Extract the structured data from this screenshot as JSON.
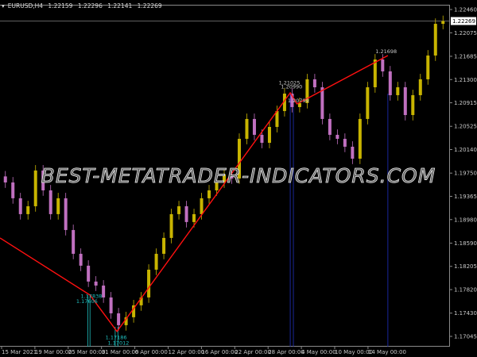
{
  "header": {
    "symbol": "EURUSD,H4",
    "open": "1.22159",
    "high": "1.22296",
    "low": "1.22141",
    "close": "1.22269"
  },
  "watermark": "BEST-METATRADER-INDICATORS.COM",
  "colors": {
    "bull": "#c8b400",
    "bear": "#c070c0",
    "zigzag": "#ff1010",
    "cyan": "#20c0c0",
    "blue": "#2030c0",
    "axis": "#8a8a8a"
  },
  "chart_data": {
    "type": "candlestick",
    "title": "EURUSD,H4",
    "ylim": [
      1.1695,
      1.2255
    ],
    "yticks": [
      "1.22460",
      "1.22075",
      "1.21685",
      "1.21300",
      "1.20915",
      "1.20525",
      "1.20140",
      "1.19750",
      "1.19365",
      "1.18980",
      "1.18590",
      "1.18205",
      "1.17820",
      "1.17430",
      "1.17045"
    ],
    "current_price": "1.22269",
    "xticks": [
      "15 Mar 2021",
      "19 Mar 00:00",
      "25 Mar 00:00",
      "31 Mar 00:00",
      "6 Apr 00:00",
      "12 Apr 00:00",
      "16 Apr 00:00",
      "22 Apr 00:00",
      "28 Apr 00:00",
      "4 May 00:00",
      "10 May 00:00",
      "14 May 00:00"
    ],
    "closes": [
      1.19595,
      1.19333,
      1.1907,
      1.19201,
      1.19793,
      1.19464,
      1.1907,
      1.19333,
      1.18807,
      1.18413,
      1.18216,
      1.17953,
      1.17887,
      1.1769,
      1.17427,
      1.1723,
      1.17362,
      1.17559,
      1.1769,
      1.1815,
      1.18413,
      1.18676,
      1.1907,
      1.19201,
      1.18939,
      1.1907,
      1.19333,
      1.19464,
      1.19595,
      1.19727,
      1.19661,
      1.20318,
      1.20647,
      1.20384,
      1.20252,
      1.20515,
      1.20778,
      1.21067,
      1.20844,
      1.2091,
      1.21304,
      1.21172,
      1.20647,
      1.20384,
      1.20318,
      1.20187,
      1.19989,
      1.20647,
      1.21172,
      1.21632,
      1.21435,
      1.21041,
      1.21172,
      1.20712,
      1.21041,
      1.21304,
      1.21698,
      1.22223,
      1.22269
    ],
    "zigzag": [
      [
        0,
        1.18675
      ],
      [
        0.2,
        1.17729
      ],
      [
        0.26,
        1.17126
      ],
      [
        0.645,
        1.2108
      ],
      [
        0.66,
        1.20896
      ],
      [
        0.862,
        1.21698
      ]
    ],
    "fractal_labels": [
      {
        "text": "1.17838",
        "pos": 0.19,
        "price": 1.1768,
        "color": "cyan"
      },
      {
        "text": "1.17606",
        "pos": 0.18,
        "price": 1.176,
        "color": "cyan"
      },
      {
        "text": "1.17186",
        "pos": 0.245,
        "price": 1.17,
        "color": "cyan"
      },
      {
        "text": "1.17012",
        "pos": 0.25,
        "price": 1.1691,
        "color": "cyan"
      },
      {
        "text": "1.21025",
        "pos": 0.63,
        "price": 1.2122,
        "color": "grey"
      },
      {
        "text": "1.20990",
        "pos": 0.635,
        "price": 1.2115,
        "color": "grey"
      },
      {
        "text": "1.20799",
        "pos": 0.65,
        "price": 1.2092,
        "color": "grey"
      },
      {
        "text": "1.21698",
        "pos": 0.845,
        "price": 1.2174,
        "color": "grey"
      }
    ],
    "vlines": [
      {
        "pos": 0.195,
        "color": "cyan"
      },
      {
        "pos": 0.2,
        "color": "cyan"
      },
      {
        "pos": 0.256,
        "color": "cyan"
      },
      {
        "pos": 0.262,
        "color": "cyan"
      },
      {
        "pos": 0.645,
        "color": "blue"
      },
      {
        "pos": 0.652,
        "color": "blue"
      },
      {
        "pos": 0.862,
        "color": "blue"
      }
    ]
  }
}
